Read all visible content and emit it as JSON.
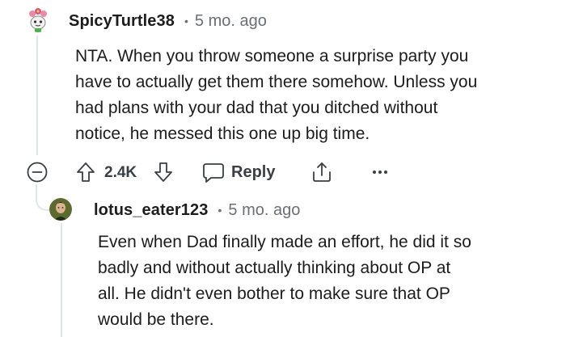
{
  "parent_comment": {
    "username": "SpicyTurtle38",
    "separator": "•",
    "age": "5 mo. ago",
    "body_lines": [
      "NTA. When you throw someone a surprise party you",
      "have to actually get them there somehow. Unless you",
      "had plans with your dad that you ditched without",
      "notice, he messed this one up big time."
    ],
    "actions": {
      "score": "2.4K",
      "reply_label": "Reply",
      "more_label": "•••"
    },
    "icons": {
      "collapse": "collapse-minus-icon",
      "upvote": "upvote-arrow-icon",
      "downvote": "downvote-arrow-icon",
      "reply": "reply-bubble-icon",
      "share": "share-icon",
      "more": "more-dots-icon"
    }
  },
  "child_comment": {
    "username": "lotus_eater123",
    "separator": "•",
    "age": "5 mo. ago",
    "body_lines": [
      "Even when Dad finally made an effort, he did it so",
      "badly and without actually thinking about OP at",
      "all. He didn't even bother to make sure that OP",
      "would be there."
    ]
  },
  "colors": {
    "text": "#1c1c1c",
    "muted": "#6a6f73",
    "thread": "#e3e6e8",
    "icon": "#3a3f44"
  }
}
